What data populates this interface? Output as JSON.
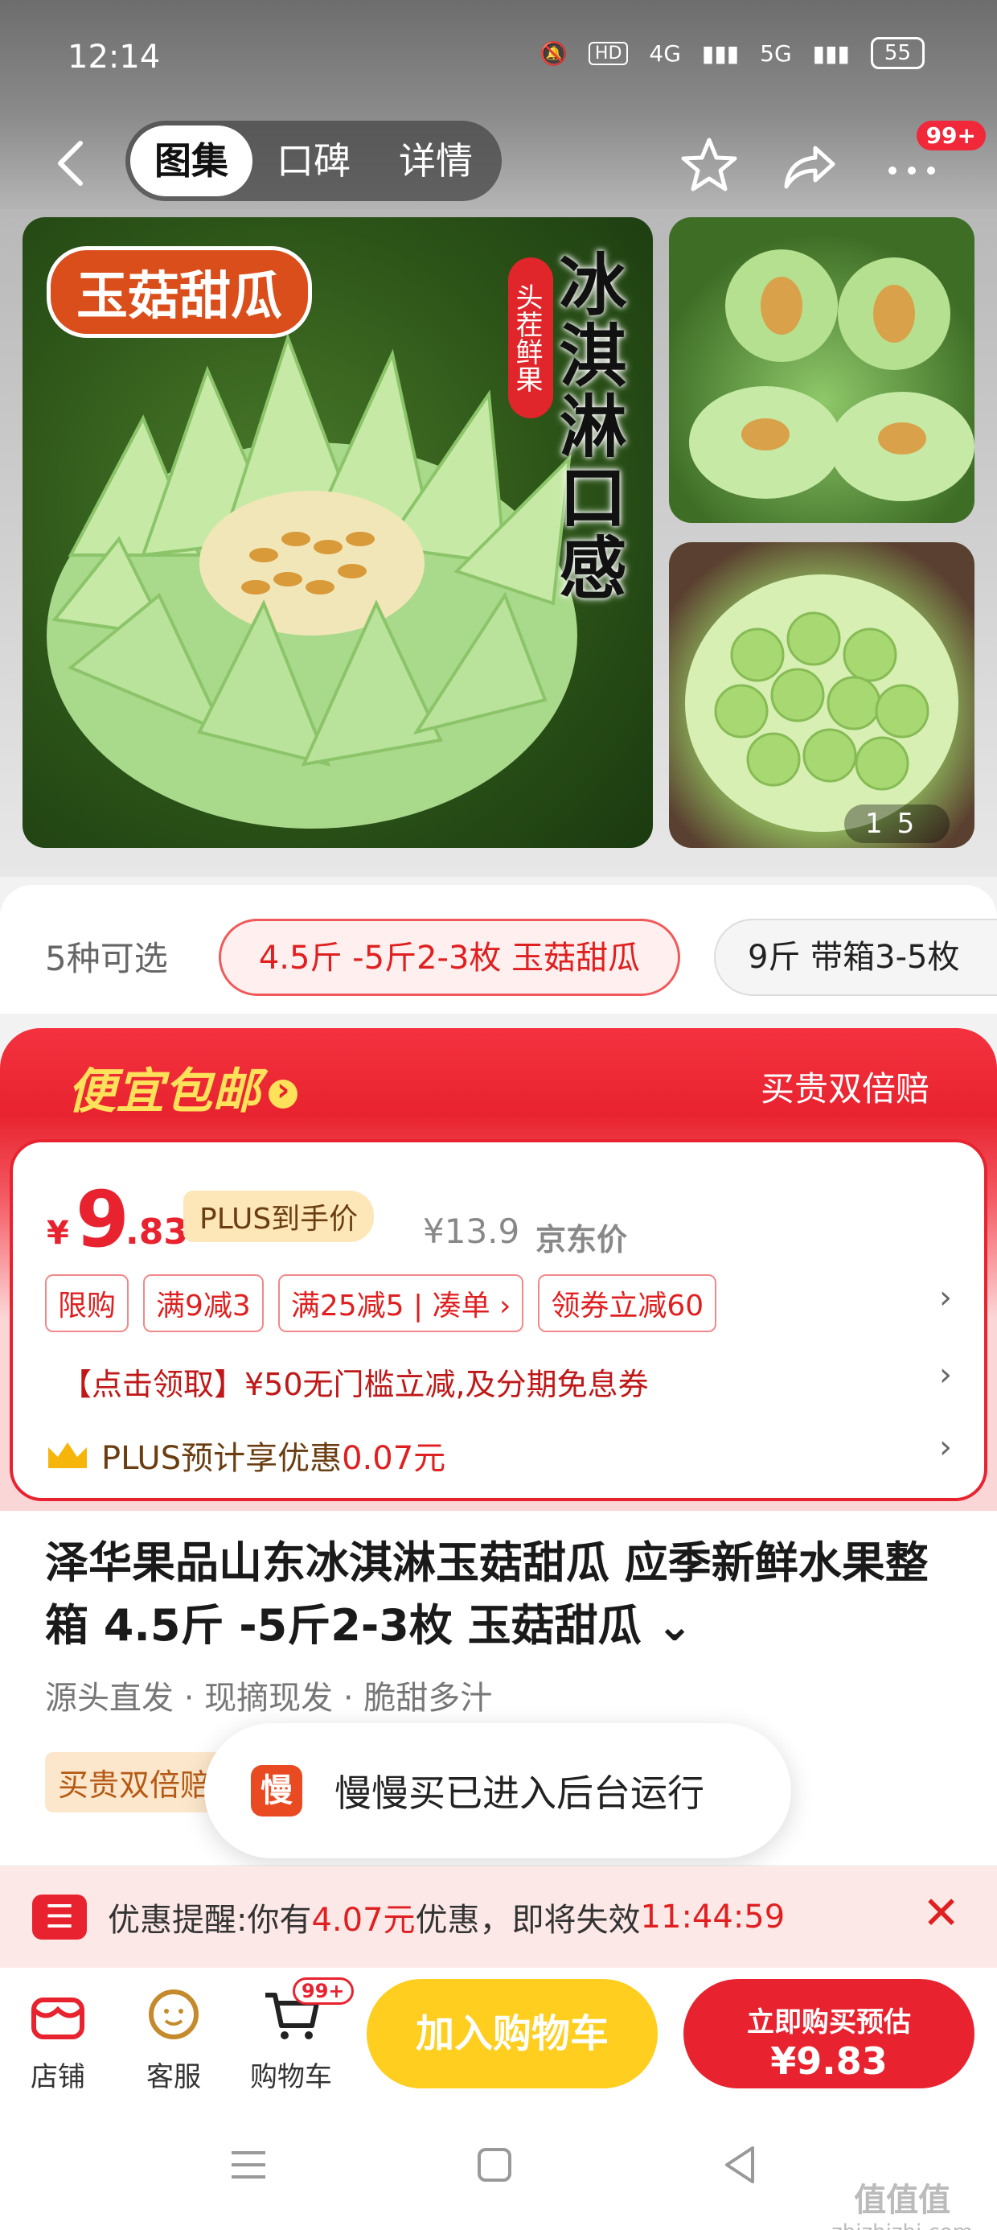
{
  "status_bar": {
    "time": "12:14",
    "hd_label": "HD",
    "network_1": "4G",
    "network_2": "5G",
    "battery": "55"
  },
  "nav": {
    "tabs": [
      {
        "label": "图集",
        "active": true
      },
      {
        "label": "口碑",
        "active": false
      },
      {
        "label": "详情",
        "active": false
      }
    ],
    "menu_badge": "99+"
  },
  "gallery": {
    "main_badge": "玉菇甜瓜",
    "main_tag": "头茬鲜果",
    "main_slogan": "冰淇淋口感",
    "page_current": "1",
    "page_total": "5"
  },
  "variants": {
    "count_label": "5种可选",
    "options": [
      {
        "label": "4.5斤 -5斤2-3枚 玉菇甜瓜",
        "selected": true
      },
      {
        "label": "9斤 带箱3-5枚",
        "selected": false
      }
    ]
  },
  "promo": {
    "title": "便宜包邮",
    "guarantee": "买贵双倍赔",
    "price_currency": "¥",
    "price_integer": "9",
    "price_decimal": ".83",
    "plus_tag": "PLUS到手价",
    "original_price": "¥13.9",
    "original_price_label": "京东价",
    "coupons": [
      "限购",
      "满9减3",
      "满25减5",
      "凑单 ›",
      "领券立减60"
    ],
    "promo_line": "【点击领取】¥50无门槛立减,及分期免息券",
    "plus_line_prefix": "PLUS预计享优惠",
    "plus_line_amount": "0.07元"
  },
  "product": {
    "title": "泽华果品山东冰淇淋玉菇甜瓜 应季新鲜水果整箱 4.5斤 -5斤2-3枚 玉菇甜瓜",
    "features": "源头直发 · 现摘现发 · 脆甜多汁",
    "feature_tag": "买贵双倍赔"
  },
  "toast": {
    "icon_text": "慢",
    "message": "慢慢买已进入后台运行"
  },
  "reminder": {
    "label": "优惠提醒:",
    "text_prefix": "你有",
    "amount": "4.07元",
    "text_mid": "优惠，即将失效",
    "countdown": "11:44:59"
  },
  "action_bar": {
    "shop_label": "店铺",
    "service_label": "客服",
    "cart_label": "购物车",
    "cart_badge": "99+",
    "add_to_cart": "加入购物车",
    "buy_now_line1": "立即购买预估",
    "buy_now_price": "¥9.83"
  },
  "watermark": {
    "line1": "值值值",
    "line2": "zhizhizhi.com"
  },
  "colors": {
    "accent_red": "#e8232f",
    "cart_yellow": "#ffce1e",
    "price_red": "#e02020"
  }
}
